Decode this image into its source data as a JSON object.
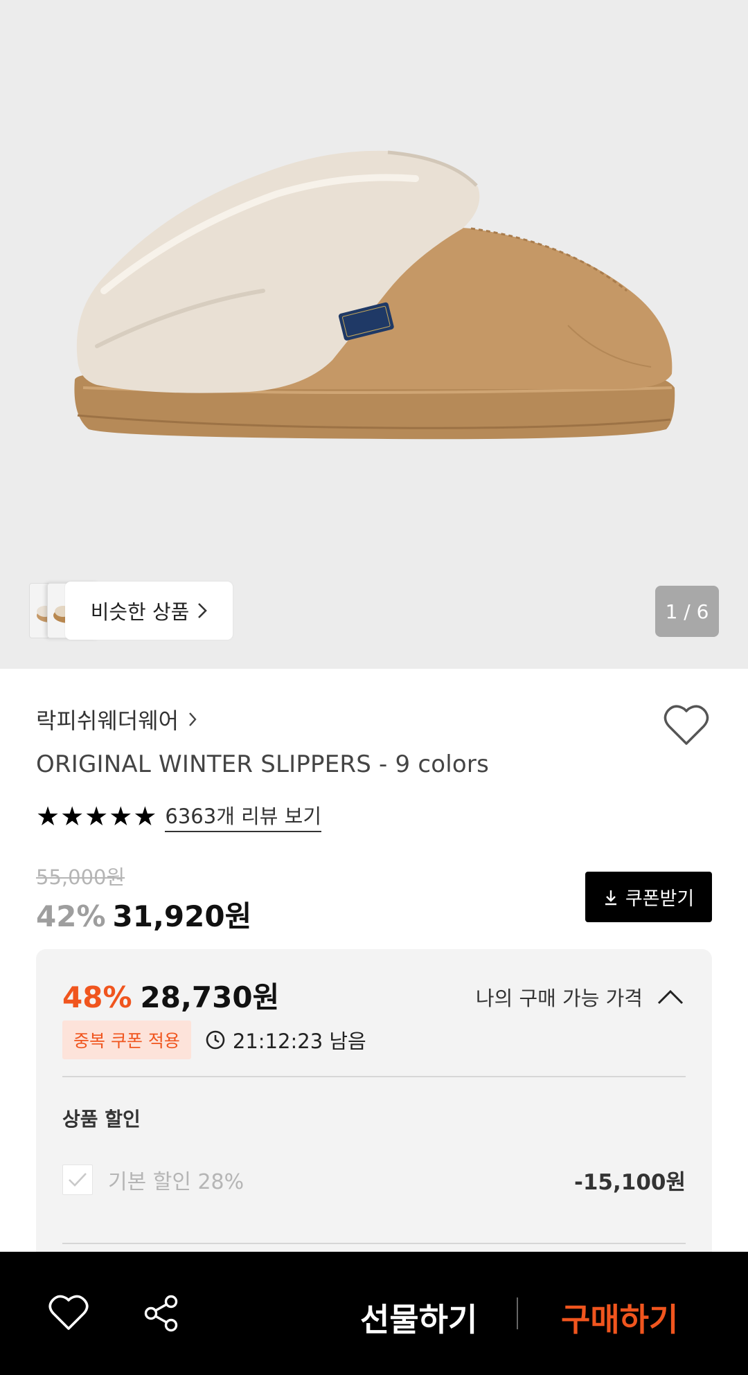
{
  "hero": {
    "pager": "1 / 6",
    "similar_label": "비슷한 상품"
  },
  "product": {
    "brand": "락피쉬웨더웨어",
    "title": "ORIGINAL WINTER SLIPPERS - 9 colors",
    "rating_stars": 5,
    "review_link": "6363개 리뷰 보기",
    "original_price": "55,000원",
    "discount_pct": "42%",
    "sale_price": "31,920원",
    "coupon_button": "쿠폰받기"
  },
  "my_price": {
    "discount_pct": "48%",
    "price": "28,730원",
    "label": "나의 구매 가능 가격",
    "badge": "중복 쿠폰 적용",
    "timer": "21:12:23 남음",
    "section_title": "상품 할인",
    "discounts": [
      {
        "label": "기본 할인 28%",
        "value": "-15,100원",
        "checked": true
      }
    ]
  },
  "bottom_bar": {
    "gift_label": "선물하기",
    "buy_label": "구매하기"
  },
  "colors": {
    "accent": "#f0551e",
    "badge_bg": "#fde3da",
    "hero_bg": "#ececec",
    "panel_bg": "#f3f3f3"
  },
  "icons": [
    "chevron-right-icon",
    "heart-icon",
    "star-icon",
    "download-icon",
    "chevron-up-icon",
    "clock-icon",
    "check-icon",
    "share-icon"
  ]
}
